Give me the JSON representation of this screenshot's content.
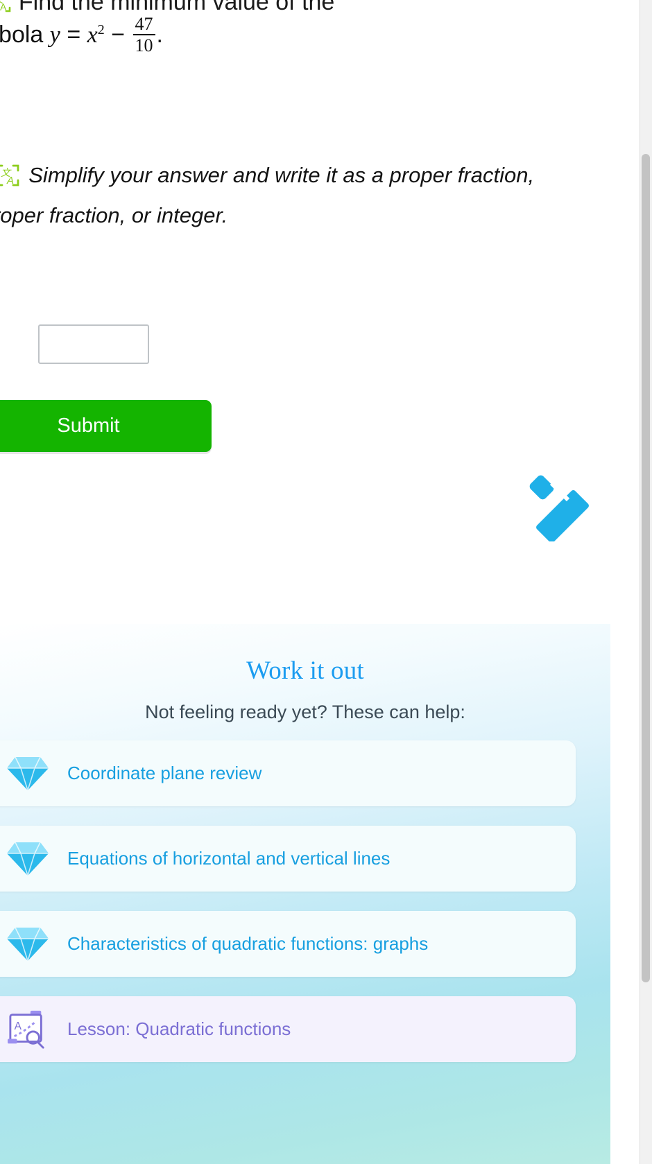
{
  "question": {
    "top_line_fragment": "Find the minimum value of the",
    "body_prefix": "parabola",
    "equation": {
      "lhs": "y",
      "equals": "=",
      "base": "x",
      "exponent": "2",
      "operator": "−",
      "fraction_numerator": "47",
      "fraction_denominator": "10",
      "period": "."
    },
    "audio_icon": "speaker-audio-icon",
    "translate_icon": "translate-icon"
  },
  "instruction": {
    "text": "Simplify your answer and write it as a proper fraction, improper fraction, or integer.",
    "audio_icon": "speaker-audio-icon",
    "translate_icon": "translate-icon"
  },
  "answer": {
    "value": "",
    "placeholder": ""
  },
  "submit": {
    "label": "Submit",
    "color": "#14b400"
  },
  "pencil": {
    "icon": "pencil-icon",
    "color": "#1fb0e8"
  },
  "work_it_out": {
    "title": "Work it out",
    "title_color": "#1b9cf0",
    "subtitle": "Not feeling ready yet? These can help:",
    "cards": [
      {
        "label": "Coordinate plane review",
        "icon": "diamond-gem-icon",
        "kind": "skill"
      },
      {
        "label": "Equations of horizontal and vertical lines",
        "icon": "diamond-gem-icon",
        "kind": "skill"
      },
      {
        "label": "Characteristics of quadratic functions: graphs",
        "icon": "diamond-gem-icon",
        "kind": "skill"
      },
      {
        "label": "Lesson: Quadratic functions",
        "icon": "lesson-board-icon",
        "kind": "lesson"
      }
    ]
  },
  "scrollbar": {
    "present": true
  }
}
